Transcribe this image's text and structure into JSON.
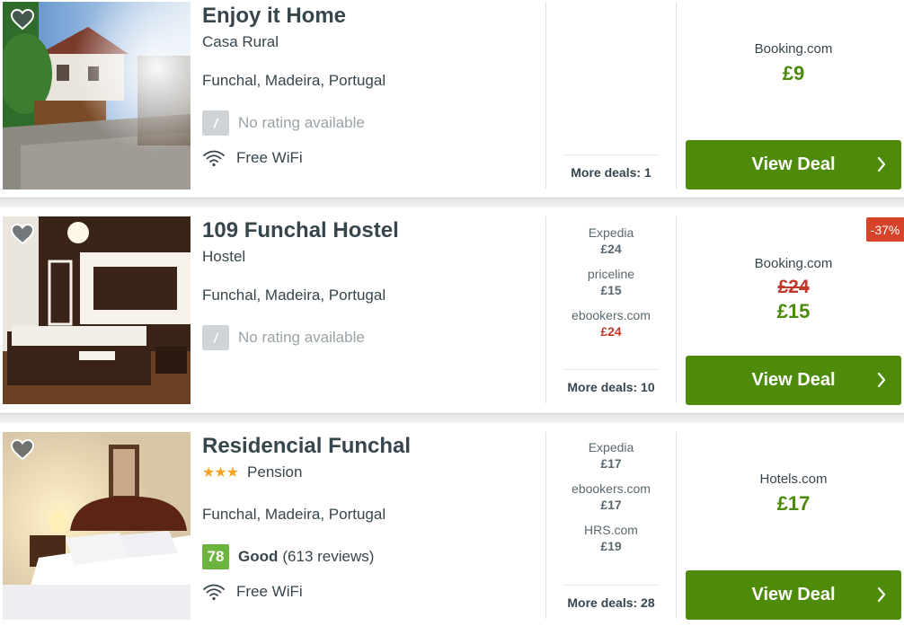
{
  "listings": [
    {
      "name": "Enjoy it Home",
      "type": "Casa Rural",
      "stars": "",
      "location": "Funchal, Madeira, Portugal",
      "rating": {
        "score": "/",
        "label": "",
        "text": "No rating available",
        "reviews": ""
      },
      "amenity": "Free WiFi",
      "alternatives": [],
      "more_deals": "More deals: 1",
      "main_site": "Booking.com",
      "old_price": "",
      "price": "£9",
      "button": "View Deal",
      "discount": ""
    },
    {
      "name": "109 Funchal Hostel",
      "type": "Hostel",
      "stars": "",
      "location": "Funchal, Madeira, Portugal",
      "rating": {
        "score": "/",
        "label": "",
        "text": "No rating available",
        "reviews": ""
      },
      "amenity": "",
      "alternatives": [
        {
          "site": "Expedia",
          "price": "£24",
          "color": "#5a6870"
        },
        {
          "site": "priceline",
          "price": "£15",
          "color": "#5a6870"
        },
        {
          "site": "ebookers.com",
          "price": "£24",
          "color": "#c0392b"
        }
      ],
      "more_deals": "More deals: 10",
      "main_site": "Booking.com",
      "old_price": "£24",
      "price": "£15",
      "button": "View Deal",
      "discount": "-37%"
    },
    {
      "name": "Residencial Funchal",
      "type": "Pension",
      "stars": "★★★",
      "location": "Funchal, Madeira, Portugal",
      "rating": {
        "score": "78",
        "label": "Good",
        "text": "",
        "reviews": "(613 reviews)"
      },
      "amenity": "Free WiFi",
      "alternatives": [
        {
          "site": "Expedia",
          "price": "£17",
          "color": "#5a6870"
        },
        {
          "site": "ebookers.com",
          "price": "£17",
          "color": "#5a6870"
        },
        {
          "site": "HRS.com",
          "price": "£19",
          "color": "#5a6870"
        }
      ],
      "more_deals": "More deals: 28",
      "main_site": "Hotels.com",
      "old_price": "",
      "price": "£17",
      "button": "View Deal",
      "discount": ""
    }
  ],
  "icons": {
    "favorite": "heart-icon",
    "wifi": "wifi-icon",
    "chevron": "chevron-right-icon"
  },
  "colors": {
    "deal_button": "#4e8b0a",
    "price_green": "#4a8a0c",
    "strike_red": "#c0392b",
    "discount_badge": "#d6432a",
    "rating_good": "#6cb33f",
    "rating_none": "#cfd3d6",
    "stars": "#f5a623"
  }
}
